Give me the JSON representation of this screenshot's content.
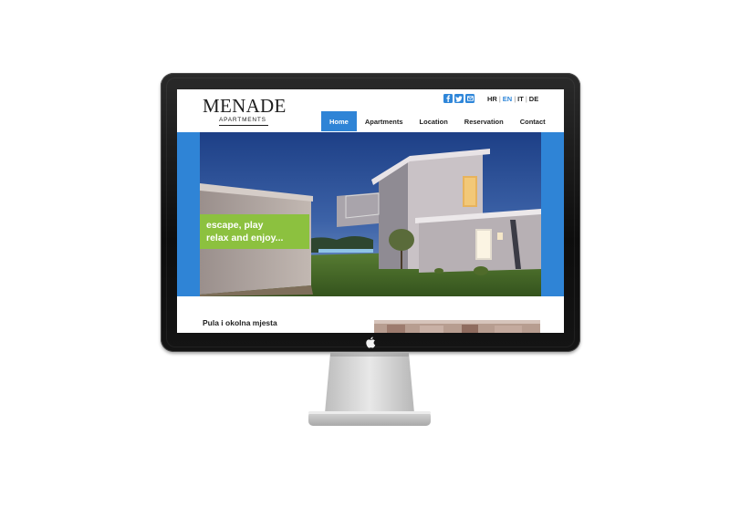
{
  "site": {
    "brand_name": "MENADE",
    "brand_sub": "APARTMENTS",
    "social_icons": [
      "facebook-icon",
      "twitter-icon",
      "email-icon"
    ],
    "languages": [
      {
        "code": "HR",
        "active": false
      },
      {
        "code": "EN",
        "active": true
      },
      {
        "code": "IT",
        "active": false
      },
      {
        "code": "DE",
        "active": false
      }
    ],
    "nav": [
      {
        "label": "Home",
        "active": true
      },
      {
        "label": "Apartments",
        "active": false
      },
      {
        "label": "Location",
        "active": false
      },
      {
        "label": "Reservation",
        "active": false
      },
      {
        "label": "Contact",
        "active": false
      }
    ],
    "tagline_line1": "escape, play",
    "tagline_line2": "relax and enjoy...",
    "section_title": "Pula i okolna mjesta"
  },
  "colors": {
    "accent_blue": "#2f84d6",
    "tagline_green": "#8cc13f"
  }
}
